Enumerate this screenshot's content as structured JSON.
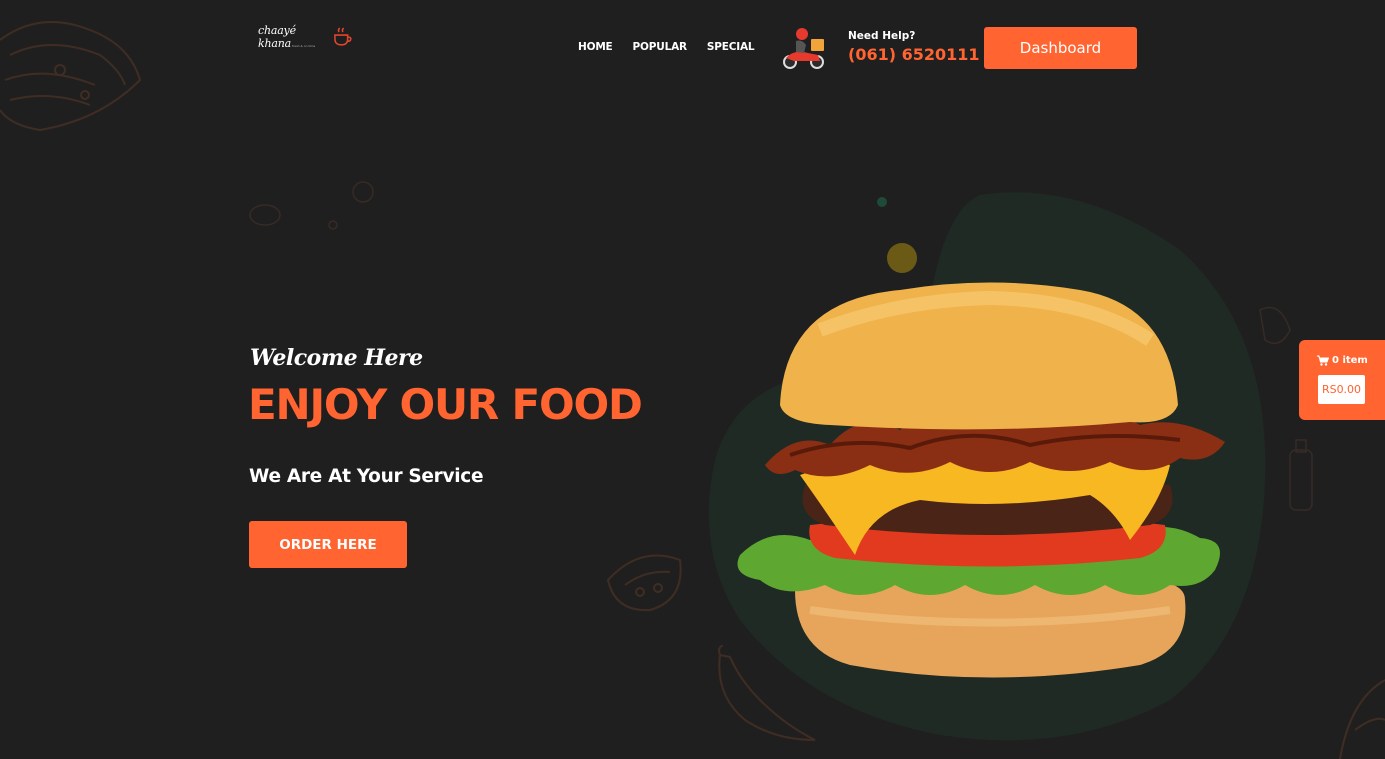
{
  "header": {
    "logo_text": "chaayé khana",
    "logo_subtext": "fresh & on time",
    "nav": [
      {
        "label": "HOME"
      },
      {
        "label": "POPULAR"
      },
      {
        "label": "SPECIAL"
      }
    ],
    "help_label": "Need Help?",
    "help_phone": "(061) 6520111",
    "dashboard_label": "Dashboard"
  },
  "hero": {
    "welcome": "Welcome Here",
    "headline": "ENJOY OUR FOOD",
    "tagline": "We Are At Your Service",
    "order_label": "ORDER HERE",
    "image": "burger-image"
  },
  "cart": {
    "icon": "cart-icon",
    "count": "0 item",
    "total": "RS0.00"
  },
  "colors": {
    "background": "#201f1f",
    "accent": "#ff6431",
    "blob": "#1f2a24"
  }
}
